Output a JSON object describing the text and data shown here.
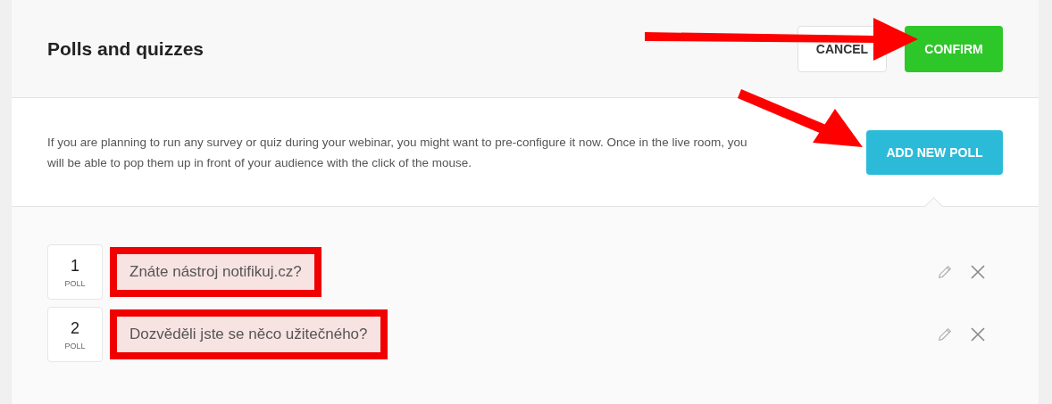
{
  "header": {
    "title": "Polls and quizzes",
    "buttons": [
      {
        "label": "CANCEL",
        "kind": "secondary"
      },
      {
        "label": "CONFIRM",
        "kind": "primary"
      }
    ]
  },
  "intro": {
    "text": "If you are planning to run any survey or quiz during your webinar, you might want to pre-configure it now. Once in the live room, you will be able to pop them up in front of your audience with the click of the mouse.",
    "button": "ADD NEW POLL"
  },
  "polls": [
    {
      "number": "1",
      "tag": "POLL",
      "question": "Znáte nástroj notifikuj.cz?",
      "highlighted": true
    },
    {
      "number": "2",
      "tag": "POLL",
      "question": "Dozvěděli jste se něco užitečného?",
      "highlighted": true
    }
  ]
}
